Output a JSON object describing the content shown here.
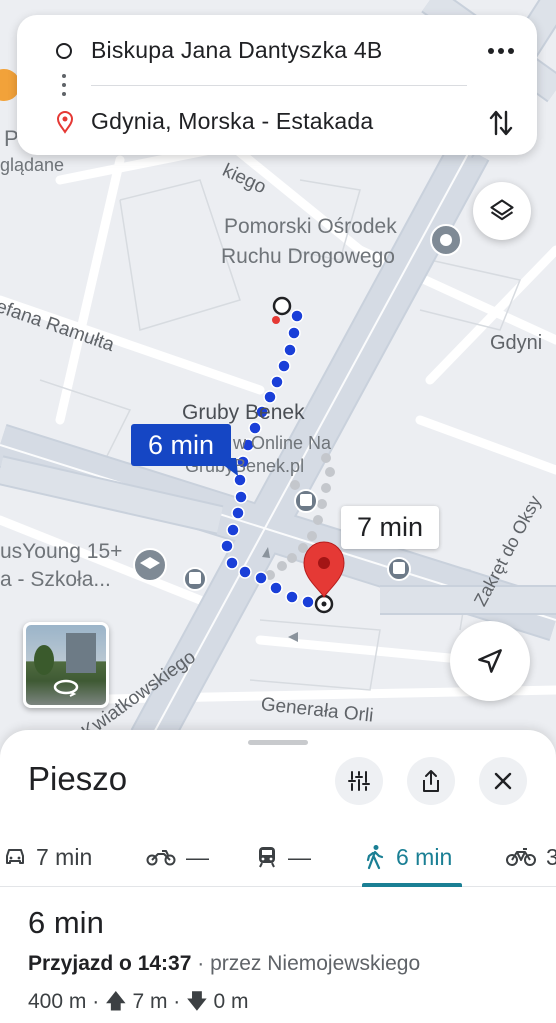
{
  "route": {
    "origin": "Biskupa Jana Dantyszka 4B",
    "destination": "Gdynia, Morska - Estakada"
  },
  "map": {
    "labels": {
      "p_fragment": "P",
      "ogladane": "glądane",
      "kiego": "kiego",
      "pomorski_line1": "Pomorski Ośrodek",
      "pomorski_line2": "Ruchu Drogowego",
      "ramutta": "efana Ramułta",
      "gdynia": "Gdyni",
      "gruby_line1": "Gruby Benek",
      "gruby_line2": "w Online Na",
      "gruby_line3": "GrubyBenek.pl",
      "zakret": "Zakręt do Oksy",
      "young_line1": "usYoung 15+",
      "young_line2": "a - Szkoła...",
      "kwiatkowskiego": "Kwiatkowskiego",
      "generala": "Generała Orli"
    },
    "walk_label": "6 min",
    "alt_label": "7 min"
  },
  "sheet": {
    "title": "Pieszo",
    "tabs": [
      {
        "mode": "car",
        "label": "7 min"
      },
      {
        "mode": "motorcycle",
        "label": "—"
      },
      {
        "mode": "transit",
        "label": "—"
      },
      {
        "mode": "walk",
        "label": "6 min"
      },
      {
        "mode": "bike",
        "label": "3"
      }
    ],
    "duration": "6 min",
    "arrival_label": "Przyjazd o 14:37",
    "via": " · przez Niemojewskiego",
    "stats": "400 m · 🡅 7 m · 🡇 0 m"
  },
  "colors": {
    "accent": "#1a7f94",
    "route_blue": "#1a3fd8",
    "pin_red": "#e53935",
    "label_blue_bg": "#1546c4"
  }
}
